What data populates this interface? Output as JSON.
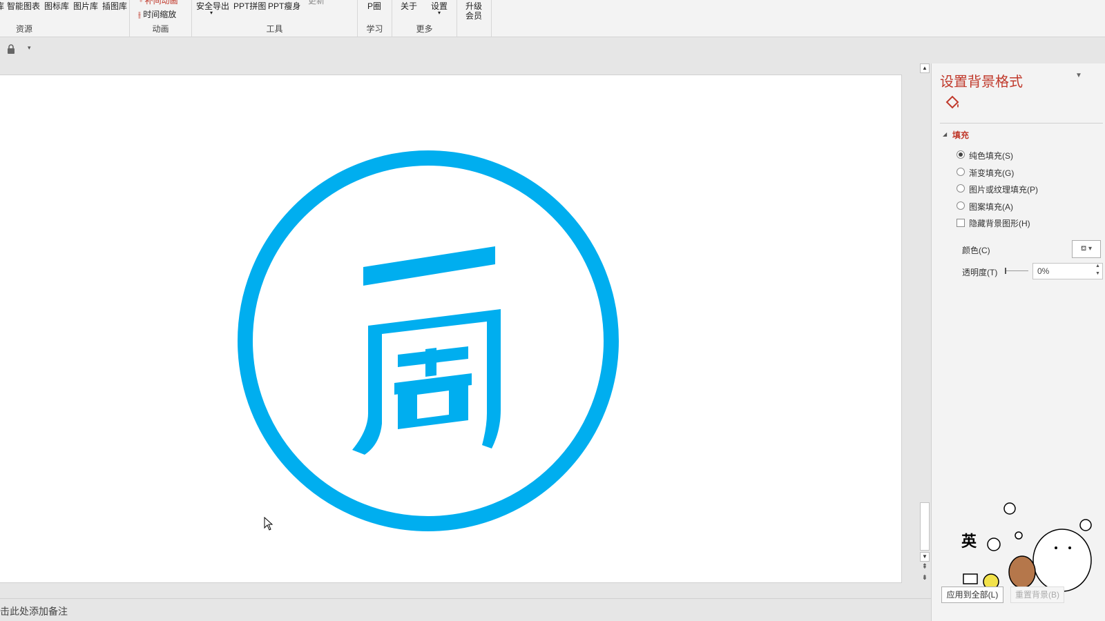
{
  "ribbon": {
    "groups": {
      "resources": {
        "label": "资源",
        "items": [
          "库",
          "智能图表",
          "图标库",
          "图片库",
          "插图库"
        ]
      },
      "animation": {
        "label": "动画",
        "item_top": "补间动画",
        "item_bottom": "时间缩放"
      },
      "tools": {
        "label": "工具",
        "items": [
          "安全导出",
          "PPT拼图",
          "PPT瘦身"
        ],
        "extra": "更新"
      },
      "learn": {
        "label": "学习",
        "items": [
          "P圈"
        ]
      },
      "more": {
        "label": "更多",
        "items": [
          "关于",
          "设置"
        ]
      },
      "upgrade": {
        "line1": "升级",
        "line2": "会员"
      }
    }
  },
  "notes": {
    "placeholder": "单击此处添加备注"
  },
  "pane": {
    "title": "设置背景格式",
    "section": "填充",
    "options": [
      {
        "label": "纯色填充(S)",
        "selected": true
      },
      {
        "label": "渐变填充(G)",
        "selected": false
      },
      {
        "label": "图片或纹理填充(P)",
        "selected": false
      },
      {
        "label": "图案填充(A)",
        "selected": false
      }
    ],
    "hide_bg": {
      "label": "隐藏背景图形(H)",
      "checked": false
    },
    "color_label": "颜色(C)",
    "transparency_label": "透明度(T)",
    "transparency_value": "0%",
    "apply_all": "应用到全部(L)",
    "reset": "重置背景(B)"
  },
  "sticker": {
    "text": "英"
  },
  "colors": {
    "logo": "#00aeef",
    "accent": "#c0392b"
  }
}
